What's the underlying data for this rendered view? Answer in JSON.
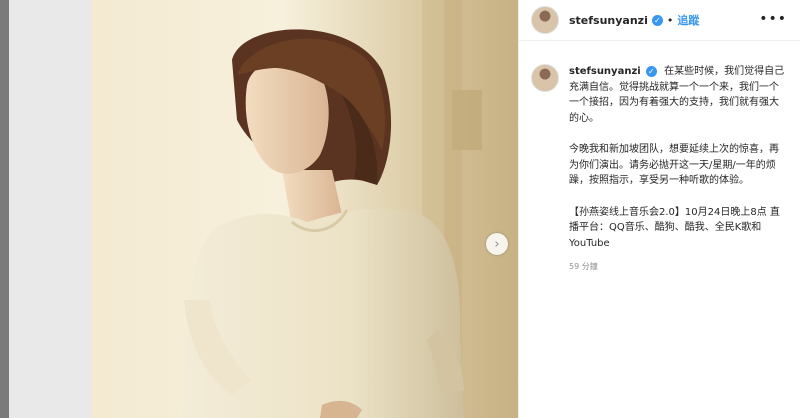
{
  "post": {
    "username": "stefsunyanzi",
    "follow_label": "追蹤",
    "more_icon": "more-horizontal-icon",
    "verified_icon": "verified-badge-icon",
    "next_icon": "chevron-right-icon",
    "caption": {
      "username": "stefsunyanzi",
      "paragraph_1": "在某些时候，我们觉得自己充满自信。觉得挑战就算一个一个来，我们一个一个接招，因为有着强大的支持，我们就有强大的心。",
      "paragraph_2": "今晚我和新加坡团队，想要延续上次的惊喜，再为你们演出。请务必抛开这一天/星期/一年的烦躁，按照指示，享受另一种听歌的体验。",
      "paragraph_3": "【孙燕姿线上音乐会2.0】10月24日晚上8点 直播平台：QQ音乐、酷狗、酷我、全民K歌和YouTube"
    },
    "timestamp": "59 分鐘"
  },
  "colors": {
    "link_blue": "#3897f0",
    "text_dark": "#262626",
    "text_muted": "#8e8e8e"
  }
}
